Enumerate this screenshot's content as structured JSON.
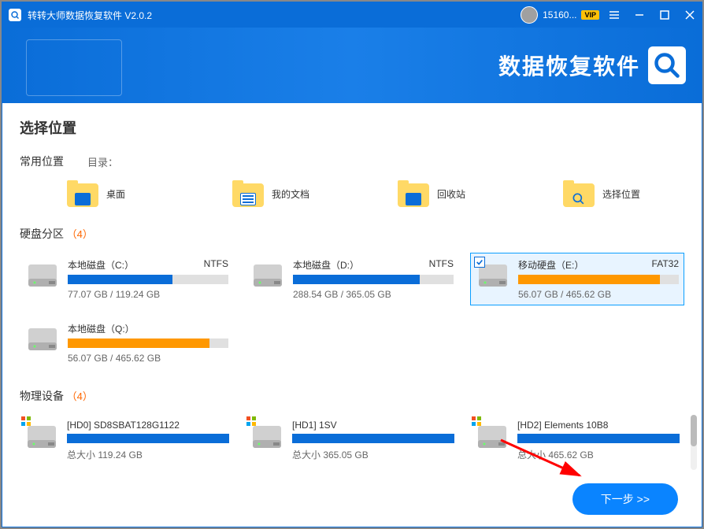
{
  "titlebar": {
    "app_title": "转转大师数据恢复软件 V2.0.2",
    "user_id": "15160...",
    "vip_label": "VIP"
  },
  "banner": {
    "title": "数据恢复软件"
  },
  "page": {
    "title": "选择位置"
  },
  "common": {
    "header": "常用位置",
    "dir_label": "目录：",
    "items": [
      {
        "label": "桌面"
      },
      {
        "label": "我的文档"
      },
      {
        "label": "回收站"
      },
      {
        "label": "选择位置"
      }
    ]
  },
  "partitions": {
    "header": "硬盘分区",
    "count": "（4）",
    "items": [
      {
        "name": "本地磁盘（C:）",
        "fs": "NTFS",
        "usage": "77.07 GB / 119.24 GB",
        "fill_pct": 65,
        "color": "blue",
        "selected": false
      },
      {
        "name": "本地磁盘（D:）",
        "fs": "NTFS",
        "usage": "288.54 GB / 365.05 GB",
        "fill_pct": 79,
        "color": "blue",
        "selected": false
      },
      {
        "name": "移动硬盘（E:）",
        "fs": "FAT32",
        "usage": "56.07 GB / 465.62 GB",
        "fill_pct": 88,
        "color": "orange",
        "selected": true
      },
      {
        "name": "本地磁盘（Q:）",
        "fs": "",
        "usage": "56.07 GB / 465.62 GB",
        "fill_pct": 88,
        "color": "orange",
        "selected": false
      }
    ]
  },
  "devices": {
    "header": "物理设备",
    "count": "（4）",
    "items": [
      {
        "name": "[HD0] SD8SBAT128G1122",
        "size": "总大小 119.24 GB"
      },
      {
        "name": "[HD1] 1SV",
        "size": "总大小 365.05 GB"
      },
      {
        "name": "[HD2] Elements 10B8",
        "size": "总大小 465.62 GB"
      }
    ]
  },
  "footer": {
    "next_label": "下一步 >>"
  }
}
